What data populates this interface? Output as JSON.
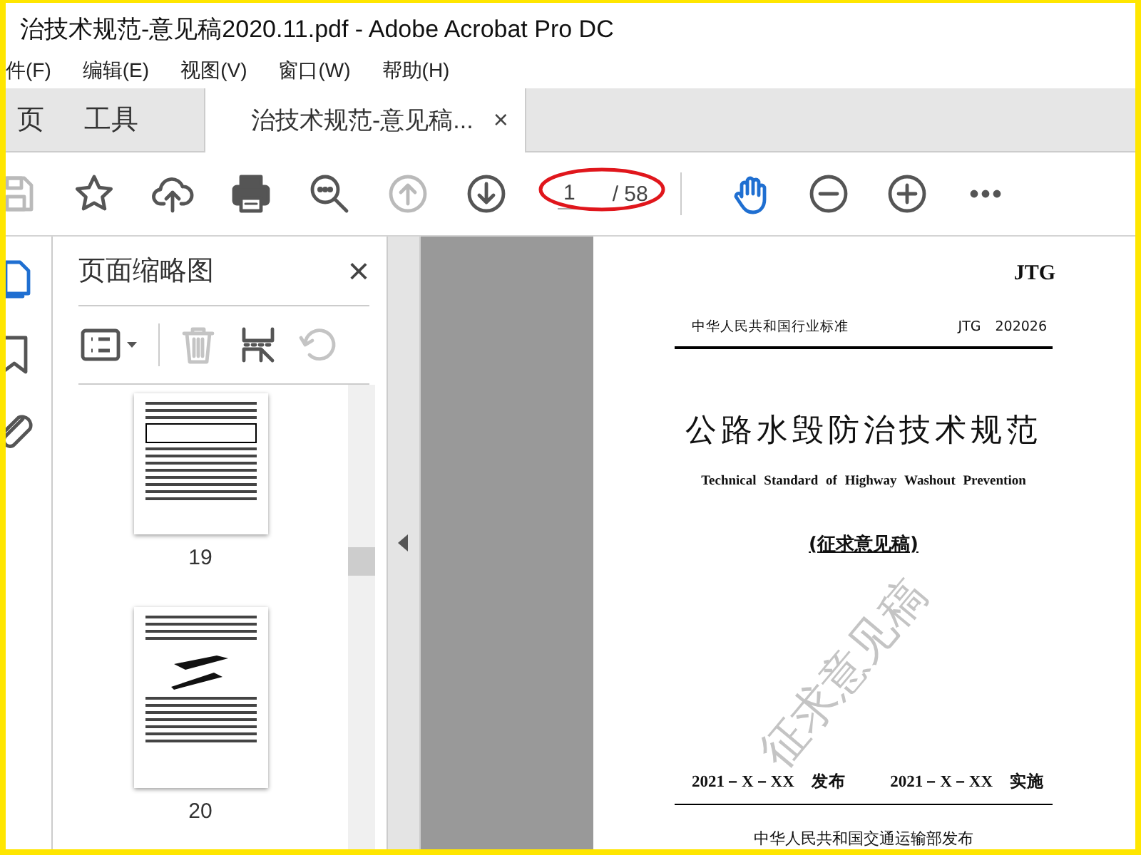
{
  "window": {
    "title": "治技术规范-意见稿2020.11.pdf - Adobe Acrobat Pro DC"
  },
  "menu": [
    "件(F)",
    "编辑(E)",
    "视图(V)",
    "窗口(W)",
    "帮助(H)"
  ],
  "tabs": [
    {
      "label": "页",
      "selected": false,
      "kind": "nav"
    },
    {
      "label": "工具",
      "selected": false,
      "kind": "nav"
    },
    {
      "label": "治技术规范-意见稿...",
      "selected": true,
      "kind": "document",
      "close": "×"
    }
  ],
  "toolbar": {
    "tools": [
      {
        "kind": "save",
        "disabled": true,
        "selected": false
      },
      {
        "kind": "star",
        "disabled": false,
        "selected": false
      },
      {
        "kind": "upload",
        "disabled": false,
        "selected": false
      },
      {
        "kind": "print",
        "disabled": false,
        "selected": false
      },
      {
        "kind": "find",
        "disabled": false,
        "selected": false
      },
      {
        "kind": "prev",
        "disabled": true,
        "selected": false
      },
      {
        "kind": "next",
        "disabled": false,
        "selected": false
      },
      {
        "kind": "page"
      },
      {
        "kind": "hand",
        "disabled": false,
        "selected": true
      },
      {
        "kind": "zoom-out",
        "disabled": false,
        "selected": false
      },
      {
        "kind": "zoom-in",
        "disabled": false,
        "selected": false
      },
      {
        "kind": "more",
        "disabled": false,
        "selected": false
      }
    ],
    "page_field": {
      "value": "1",
      "total": "/ 58",
      "circled": true
    }
  },
  "rail": [
    {
      "kind": "pages",
      "selected": true
    },
    {
      "kind": "bookmark",
      "selected": false
    },
    {
      "kind": "attachment",
      "selected": false
    }
  ],
  "panel": {
    "title": "页面缩略图",
    "close": "×",
    "tools": [
      {
        "kind": "options",
        "disabled": false
      },
      {
        "kind": "delete",
        "disabled": true
      },
      {
        "kind": "insert",
        "disabled": false
      },
      {
        "kind": "undo",
        "disabled": true
      }
    ],
    "thumbnails": [
      {
        "label": "19",
        "kind": "table"
      },
      {
        "label": "20",
        "kind": "figure"
      }
    ]
  },
  "document": {
    "mark": "JTG",
    "category": "中华人民共和国行业标准",
    "code": "JTG　202026",
    "title": "公路水毁防治技术规范",
    "subtitle": "Technical Standard of Highway Washout Prevention",
    "draft_label": "(征求意见稿)",
    "watermark": "征求意见稿",
    "issue_date": "2021－X－XX　发布",
    "effective_date": "2021－X－XX　实施",
    "publisher": "中华人民共和国交通运输部发布"
  }
}
